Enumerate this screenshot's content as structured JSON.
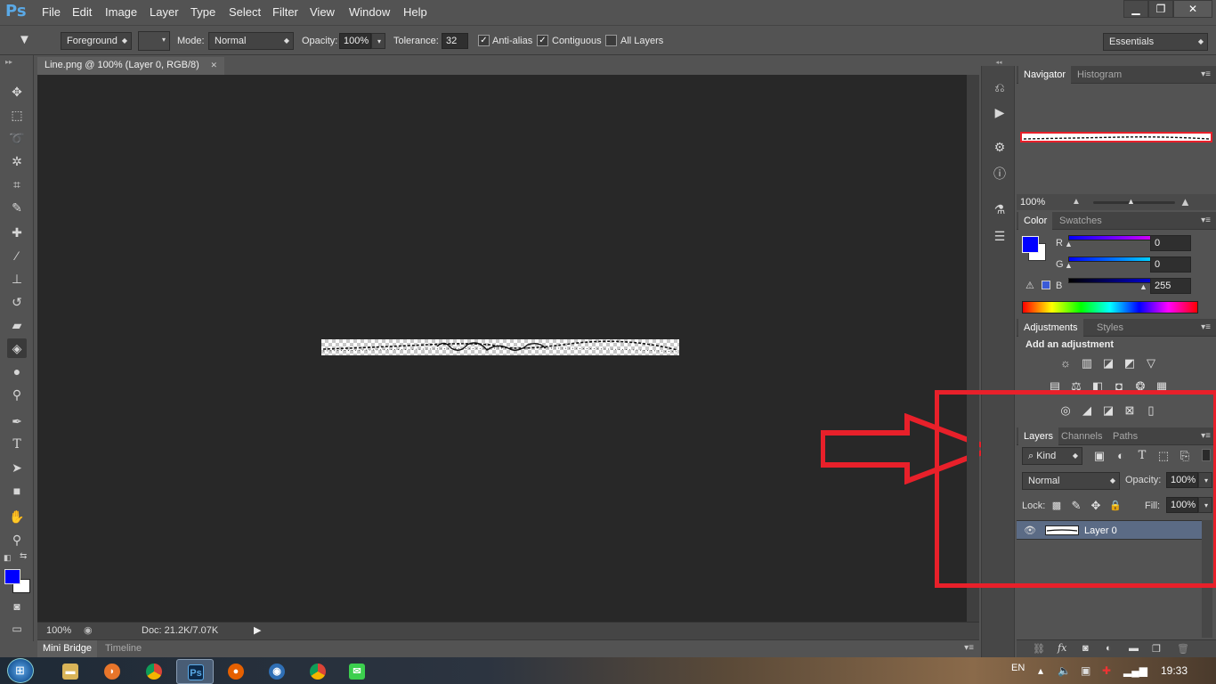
{
  "app": {
    "logo": "Ps"
  },
  "menu": [
    "File",
    "Edit",
    "Image",
    "Layer",
    "Type",
    "Select",
    "Filter",
    "View",
    "Window",
    "Help"
  ],
  "window_controls": {
    "minimize": "▁",
    "restore": "❐",
    "close": "✕"
  },
  "options": {
    "source": "Foreground",
    "mode_label": "Mode:",
    "mode_value": "Normal",
    "opacity_label": "Opacity:",
    "opacity_value": "100%",
    "tolerance_label": "Tolerance:",
    "tolerance_value": "32",
    "antialias_label": "Anti-alias",
    "antialias_checked": true,
    "contiguous_label": "Contiguous",
    "contiguous_checked": true,
    "alllayers_label": "All Layers",
    "alllayers_checked": false,
    "workspace": "Essentials"
  },
  "document": {
    "tab_title": "Line.png @ 100% (Layer 0, RGB/8)",
    "close": "✕"
  },
  "status": {
    "zoom": "100%",
    "doc_info": "Doc: 21.2K/7.07K"
  },
  "bottom_tabs": [
    "Mini Bridge",
    "Timeline"
  ],
  "toolbox": [
    "move-tool",
    "marquee-tool",
    "lasso-tool",
    "magic-wand-tool",
    "crop-tool",
    "eyedropper-tool",
    "healing-brush-tool",
    "brush-tool",
    "clone-stamp-tool",
    "history-brush-tool",
    "eraser-tool",
    "paint-bucket-tool",
    "blur-tool",
    "dodge-tool",
    "pen-tool",
    "type-tool",
    "path-selection-tool",
    "rectangle-tool",
    "hand-tool",
    "zoom-tool"
  ],
  "colors": {
    "foreground": "#0000ff",
    "background": "#ffffff",
    "annotation": "#e8202a"
  },
  "navigator": {
    "tabs": [
      "Navigator",
      "Histogram"
    ],
    "zoom": "100%"
  },
  "color_panel": {
    "tabs": [
      "Color",
      "Swatches"
    ],
    "channels": [
      {
        "label": "R",
        "value": "0",
        "level": 0
      },
      {
        "label": "G",
        "value": "0",
        "level": 0
      },
      {
        "label": "B",
        "value": "255",
        "level": 1
      }
    ]
  },
  "adjustments": {
    "tabs": [
      "Adjustments",
      "Styles"
    ],
    "heading": "Add an adjustment"
  },
  "layers": {
    "tabs": [
      "Layers",
      "Channels",
      "Paths"
    ],
    "filter_kind": "Kind",
    "blend_mode": "Normal",
    "opacity_label": "Opacity:",
    "opacity_value": "100%",
    "lock_label": "Lock:",
    "fill_label": "Fill:",
    "fill_value": "100%",
    "items": [
      {
        "name": "Layer 0",
        "visible": true
      }
    ]
  },
  "taskbar": {
    "language": "EN",
    "time": "19:33"
  }
}
